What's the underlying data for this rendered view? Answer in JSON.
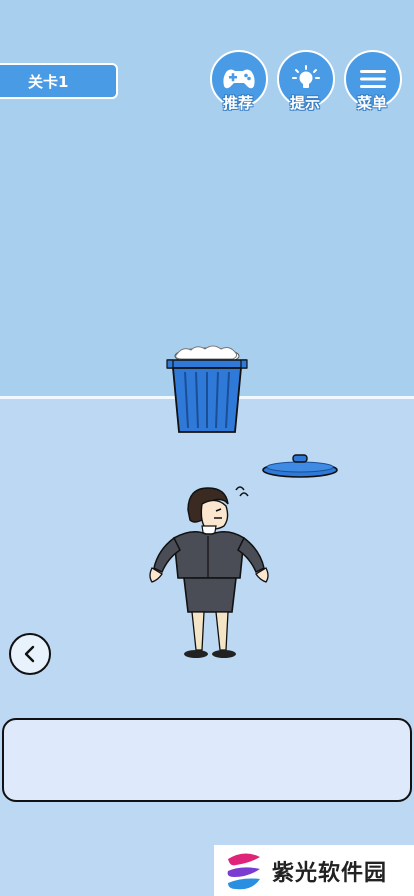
{
  "level": {
    "label": "关卡1"
  },
  "top_buttons": [
    {
      "id": "recommend",
      "label": "推荐",
      "icon": "gamepad-icon"
    },
    {
      "id": "hint",
      "label": "提示",
      "icon": "lightbulb-icon"
    },
    {
      "id": "menu",
      "label": "菜单",
      "icon": "hamburger-menu-icon"
    }
  ],
  "scene": {
    "objects": [
      "trash-can",
      "trash-can-lid",
      "office-worker-woman"
    ]
  },
  "answer_box": {
    "text": ""
  },
  "watermark": {
    "text": "紫光软件园",
    "logo": "ziguang-logo"
  },
  "colors": {
    "wall": "#a9cfef",
    "floor": "#bcd8f3",
    "button_blue": "#4a9be6",
    "trash_blue": "#2f79d9"
  }
}
